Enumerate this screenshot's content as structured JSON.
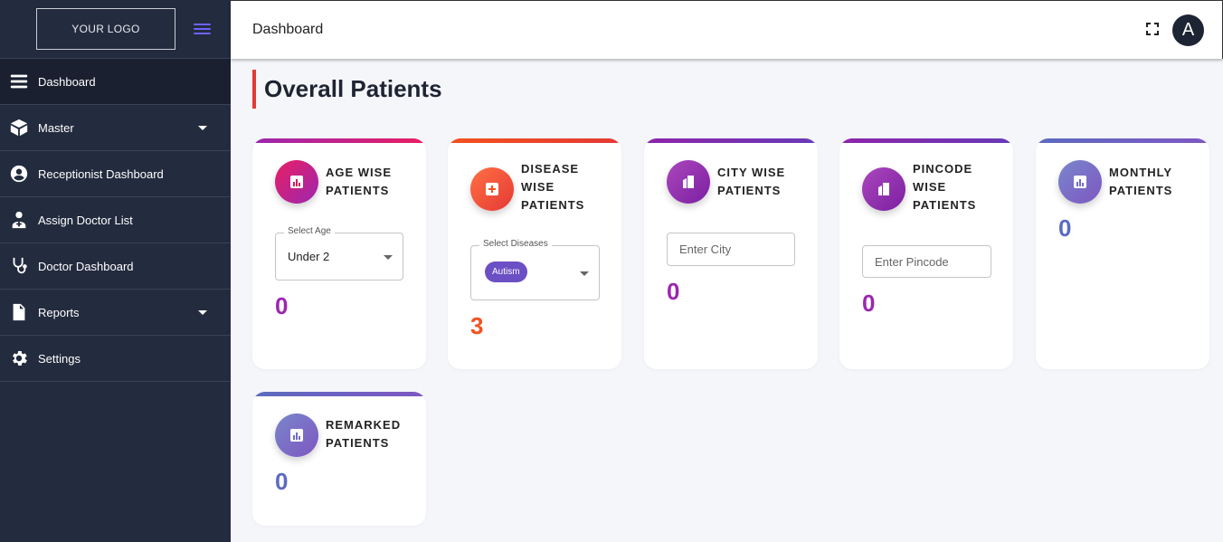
{
  "sidebar": {
    "logo_text": "YOUR LOGO",
    "items": [
      {
        "label": "Dashboard",
        "icon": "menu-lines-icon",
        "active": true
      },
      {
        "label": "Master",
        "icon": "cube-icon",
        "has_submenu": true
      },
      {
        "label": "Receptionist Dashboard",
        "icon": "user-circle-icon"
      },
      {
        "label": "Assign Doctor List",
        "icon": "doctor-icon"
      },
      {
        "label": "Doctor Dashboard",
        "icon": "stethoscope-icon"
      },
      {
        "label": "Reports",
        "icon": "document-icon",
        "has_submenu": true
      },
      {
        "label": "Settings",
        "icon": "gear-icon"
      }
    ]
  },
  "topbar": {
    "title": "Dashboard",
    "avatar_letter": "A"
  },
  "main": {
    "section_title": "Overall Patients"
  },
  "cards": {
    "age": {
      "title_line1": "AGE WISE",
      "title_line2": "PATIENTS",
      "select_label": "Select Age",
      "select_value": "Under 2",
      "count": "0",
      "count_color": "#9c27b0"
    },
    "disease": {
      "title_line1": "DISEASE",
      "title_line2": "WISE",
      "title_line3": "PATIENTS",
      "select_label": "Select Diseases",
      "chip": "Autism",
      "count": "3",
      "count_color": "#f4511e"
    },
    "city": {
      "title_line1": "CITY WISE",
      "title_line2": "PATIENTS",
      "placeholder": "Enter City",
      "count": "0",
      "count_color": "#9c27b0"
    },
    "pincode": {
      "title_line1": "PINCODE",
      "title_line2": "WISE",
      "title_line3": "PATIENTS",
      "placeholder": "Enter Pincode",
      "count": "0",
      "count_color": "#9c27b0"
    },
    "monthly": {
      "title_line1": "MONTHLY",
      "title_line2": "PATIENTS",
      "count": "0",
      "count_color": "#5c6bc0"
    },
    "remarked": {
      "title_line1": "REMARKED",
      "title_line2": "PATIENTS",
      "count": "0",
      "count_color": "#5c6bc0"
    }
  },
  "colors": {
    "sidebar_bg": "#232b3e",
    "accent_red": "#e53935",
    "magenta": "#d81b60",
    "orange": "#f4511e",
    "purple": "#8e24aa",
    "indigo": "#5c6bc0"
  }
}
